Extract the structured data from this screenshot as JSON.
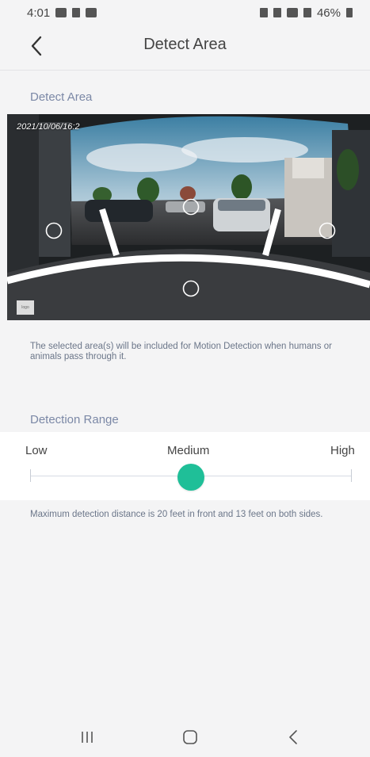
{
  "status_bar": {
    "time": "4:01",
    "battery": "46%",
    "icons": [
      "gallery-icon",
      "notification-icon",
      "media-icon",
      "mute-icon",
      "alarm-icon",
      "wifi-icon",
      "signal-icon",
      "battery-icon"
    ]
  },
  "header": {
    "title": "Detect Area",
    "back_icon": "chevron-left-icon"
  },
  "detect_area": {
    "label": "Detect Area",
    "timestamp": "2021/10/06/16:2",
    "logo": "logo",
    "description": "The selected area(s) will be included for Motion Detection when humans or animals pass through it."
  },
  "detection_range": {
    "label": "Detection Range",
    "levels": [
      "Low",
      "Medium",
      "High"
    ],
    "selected": "Medium",
    "selected_index": 1,
    "accent_color": "#1fbf98",
    "note": "Maximum detection distance is 20 feet in front and 13 feet on both sides."
  },
  "system_nav": [
    "recents-icon",
    "home-icon",
    "back-icon"
  ]
}
